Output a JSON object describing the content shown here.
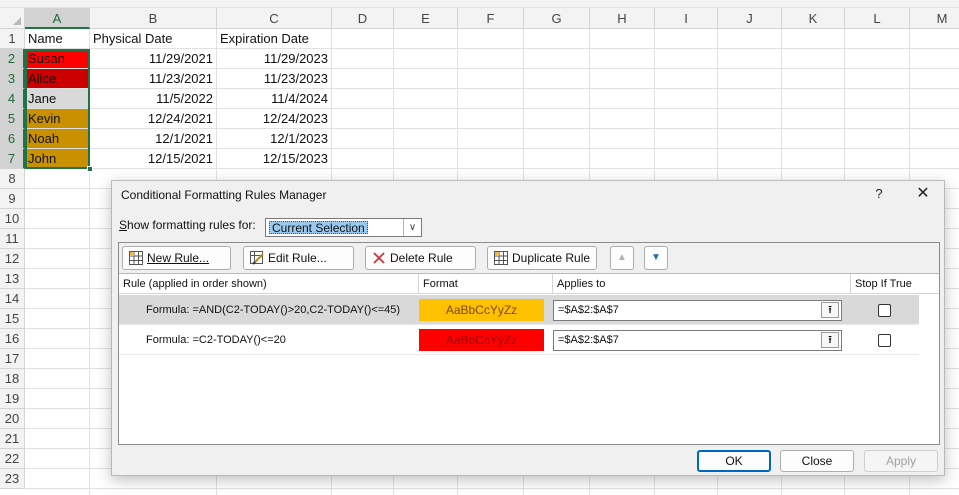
{
  "sheet": {
    "columns": [
      "A",
      "B",
      "C",
      "D",
      "E",
      "F",
      "G",
      "H",
      "I",
      "J",
      "K",
      "L",
      "M"
    ],
    "rows": [
      "1",
      "2",
      "3",
      "4",
      "5",
      "6",
      "7",
      "8",
      "9",
      "10",
      "11",
      "12",
      "13",
      "14",
      "15",
      "16",
      "17",
      "18",
      "19",
      "20",
      "21",
      "22",
      "23"
    ],
    "header": {
      "name": "Name",
      "physical": "Physical Date",
      "expiration": "Expiration Date"
    },
    "data": [
      {
        "name": "Susan",
        "physical": "11/29/2021",
        "expiration": "11/29/2023",
        "fill": "#ff0000"
      },
      {
        "name": "Alice",
        "physical": "11/23/2021",
        "expiration": "11/23/2023",
        "fill": "#cc0000"
      },
      {
        "name": "Jane",
        "physical": "11/5/2022",
        "expiration": "11/4/2024",
        "fill": "#d9d9d9"
      },
      {
        "name": "Kevin",
        "physical": "12/24/2021",
        "expiration": "12/24/2023",
        "fill": "#c99100"
      },
      {
        "name": "Noah",
        "physical": "12/1/2021",
        "expiration": "12/1/2023",
        "fill": "#c99100"
      },
      {
        "name": "John",
        "physical": "12/15/2021",
        "expiration": "12/15/2023",
        "fill": "#c99100"
      }
    ],
    "selected_column": "A",
    "selected_rows": [
      "2",
      "3",
      "4",
      "5",
      "6",
      "7"
    ]
  },
  "dialog": {
    "title": "Conditional Formatting Rules Manager",
    "help": "?",
    "close": "✕",
    "show_rules_for_label": "Show formatting rules for:",
    "show_rules_for_value": "Current Selection",
    "toolbar": {
      "new_rule": "New Rule...",
      "edit_rule": "Edit Rule...",
      "delete_rule": "Delete Rule",
      "duplicate_rule": "Duplicate Rule",
      "move_up": "▲",
      "move_down": "▼"
    },
    "headers": {
      "rule": "Rule (applied in order shown)",
      "format": "Format",
      "applies_to": "Applies to",
      "stop_if_true": "Stop If True"
    },
    "rules": [
      {
        "rule": "Formula: =AND(C2-TODAY()>20,C2-TODAY()<=45)",
        "preview": "AaBbCcYyZz",
        "preview_bg": "#ffc000",
        "preview_fg": "#7a4b00",
        "applies_to": "=$A$2:$A$7",
        "stop_if_true": false,
        "selected": true
      },
      {
        "rule": "Formula: =C2-TODAY()<=20",
        "preview": "AaBbCcYyZz",
        "preview_bg": "#ff0000",
        "preview_fg": "#9c0006",
        "applies_to": "=$A$2:$A$7",
        "stop_if_true": false,
        "selected": false
      }
    ],
    "buttons": {
      "ok": "OK",
      "close": "Close",
      "apply": "Apply"
    }
  },
  "colors": {
    "excel_green": "#217346",
    "ok_border": "#0067c0"
  }
}
